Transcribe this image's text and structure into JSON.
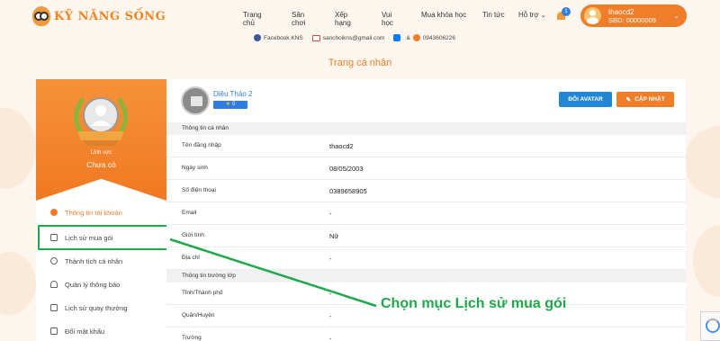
{
  "header": {
    "logo_text": "KỸ NĂNG SỐNG",
    "nav": [
      "Trang chủ",
      "Sân chơi",
      "Xếp hạng",
      "Vui học",
      "Mua khóa học",
      "Tin tức",
      "Hỗ trợ"
    ],
    "notification_count": "1",
    "user": {
      "name": "thaocd2",
      "sbd": "SBD: 00000009"
    }
  },
  "contact": {
    "facebook": "Facebook KNS",
    "email": "sanchoikns@gmail.com",
    "ampersand": "&",
    "phone": "0943606226"
  },
  "page_title": "Trang cá nhân",
  "sidebar": {
    "rank_label": "Lĩnh vực",
    "rank_value": "Chưa có",
    "items": [
      {
        "label": "Thông tin tài khoản",
        "active": true
      },
      {
        "label": "Lịch sử mua gói",
        "active": false
      },
      {
        "label": "Thành tích cá nhân",
        "active": false
      },
      {
        "label": "Quản lý thông báo",
        "active": false
      },
      {
        "label": "Lịch sử quay thưởng",
        "active": false
      },
      {
        "label": "Đổi mật khẩu",
        "active": false
      }
    ]
  },
  "profile": {
    "name": "Diệu Thảo 2",
    "stars": "0",
    "change_avatar": "ĐỔI AVATAR",
    "update": "CẬP NHẬT"
  },
  "personal_info": {
    "title": "Thông tin cá nhân",
    "rows": [
      {
        "label": "Tên đăng nhập",
        "value": "thaocd2"
      },
      {
        "label": "Ngày sinh",
        "value": "08/05/2003"
      },
      {
        "label": "Số điện thoại",
        "value": "0389658905"
      },
      {
        "label": "Email",
        "value": "-"
      },
      {
        "label": "Giới tính",
        "value": "Nữ"
      },
      {
        "label": "Địa chỉ",
        "value": "-"
      }
    ]
  },
  "school_info": {
    "title": "Thông tin trường lớp",
    "rows": [
      {
        "label": "Tỉnh/Thành phố",
        "value": "-"
      },
      {
        "label": "Quận/Huyện",
        "value": "-"
      },
      {
        "label": "Trường",
        "value": "-"
      }
    ]
  },
  "annotation": {
    "text": "Chọn mục Lịch sử mua gói",
    "color": "#1fa94a"
  },
  "colors": {
    "brand": "#f07d28",
    "link": "#2e7de1"
  }
}
